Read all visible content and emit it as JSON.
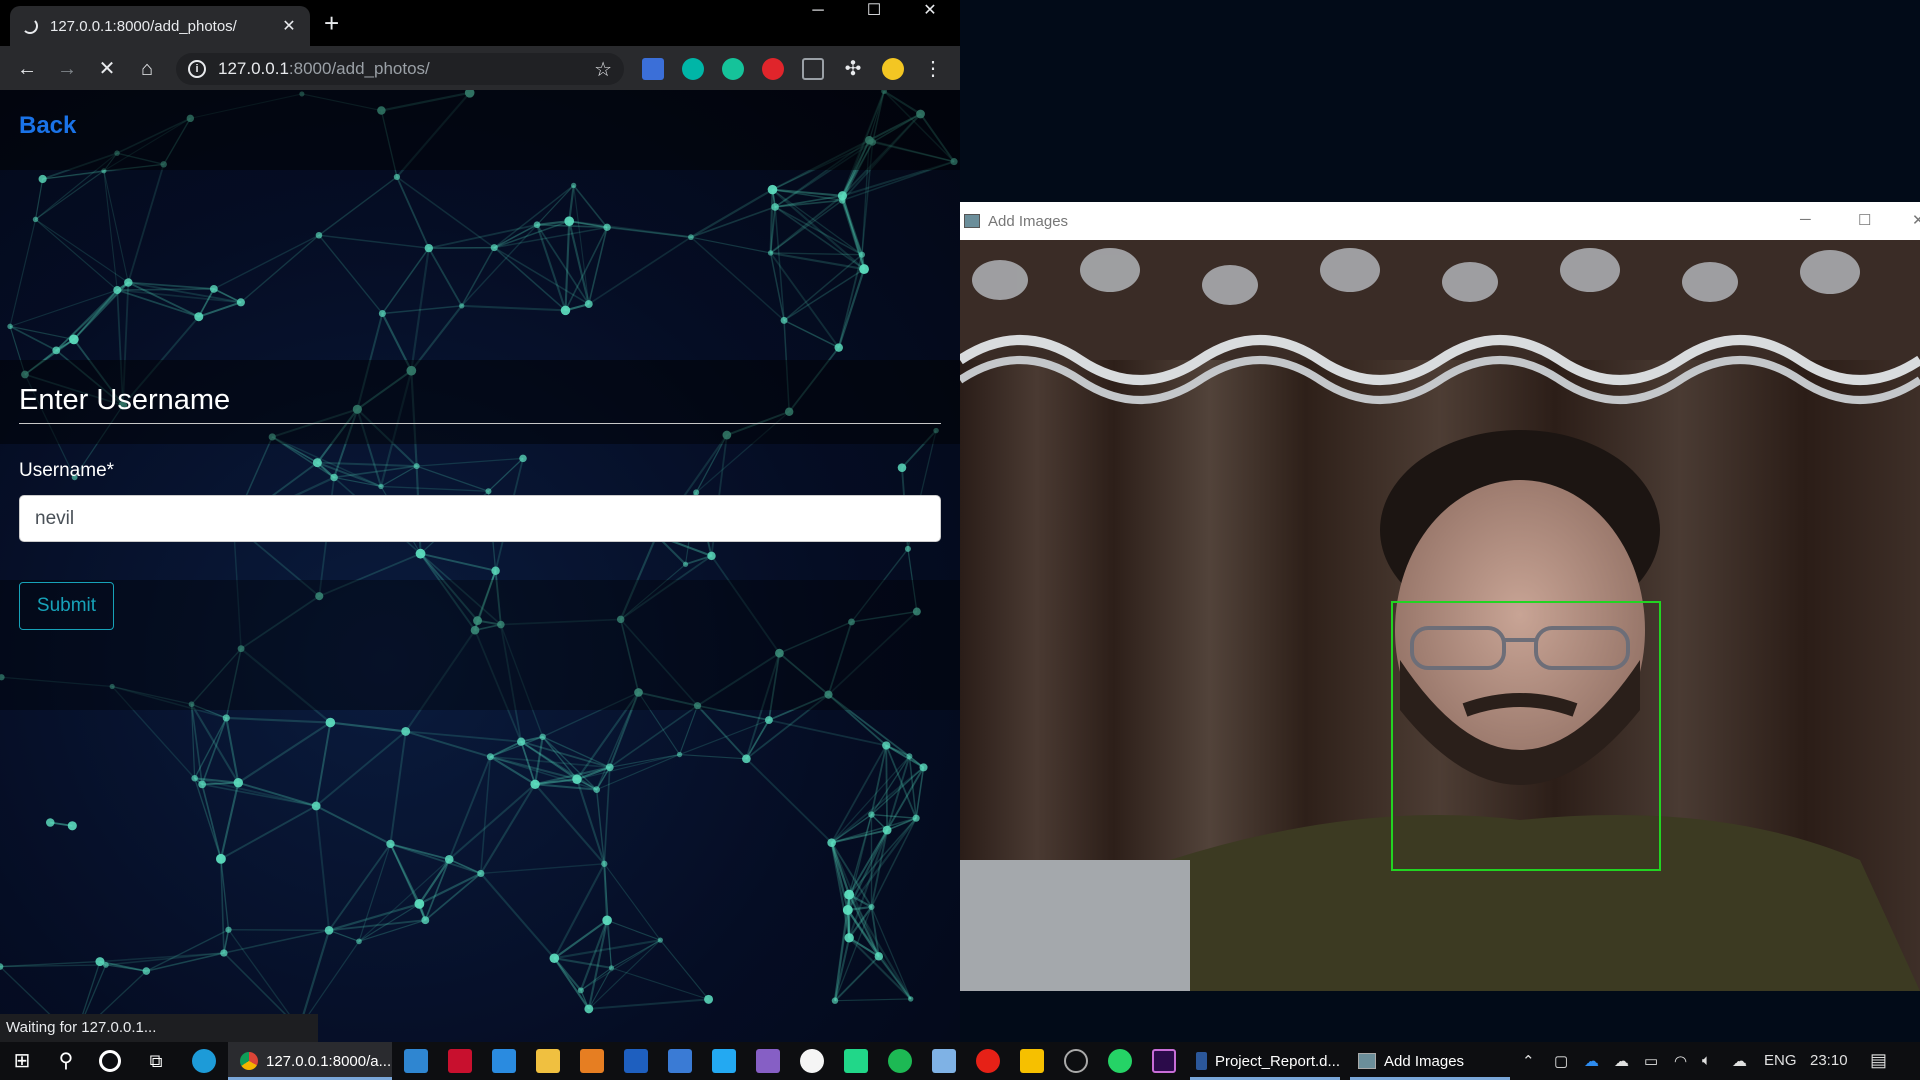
{
  "browser": {
    "tab_title": "127.0.0.1:8000/add_photos/",
    "url_host": "127.0.0.1",
    "url_path": ":8000/add_photos/",
    "status_text": "Waiting for 127.0.0.1..."
  },
  "page": {
    "back_label": "Back",
    "form_title": "Enter Username",
    "username_label": "Username*",
    "username_value": "nevil",
    "submit_label": "Submit",
    "accent_link": "#1a73e8",
    "accent_submit": "#17a2b8"
  },
  "cv_window": {
    "title": "Add Images",
    "face_box_color": "#22d422"
  },
  "taskbar": {
    "chrome_label": "127.0.0.1:8000/a...",
    "word_label": "Project_Report.d...",
    "cv_label": "Add Images",
    "lang": "ENG",
    "time": "23:10"
  }
}
